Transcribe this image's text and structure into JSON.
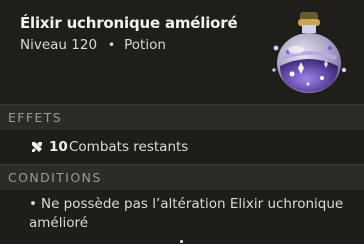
{
  "item": {
    "name": "Élixir uchronique amélioré",
    "level": "Niveau 120",
    "type": "Potion",
    "image_icon": "purple-elixir-bottle-icon"
  },
  "effects": {
    "header": "EFFETS",
    "items": [
      {
        "icon": "crossed-swords-icon",
        "count": "10",
        "text": "Combats restants"
      }
    ]
  },
  "conditions": {
    "header": "CONDITIONS",
    "items": [
      {
        "text": "Ne possède pas l’altération Elixir uchronique amélioré"
      }
    ]
  },
  "colors": {
    "background": "#1e1d1a",
    "section_header": "#2c2b27",
    "text_primary": "#f4f2ee",
    "text_muted": "#9c9a94",
    "potion_purple": "#6a4fb3"
  }
}
